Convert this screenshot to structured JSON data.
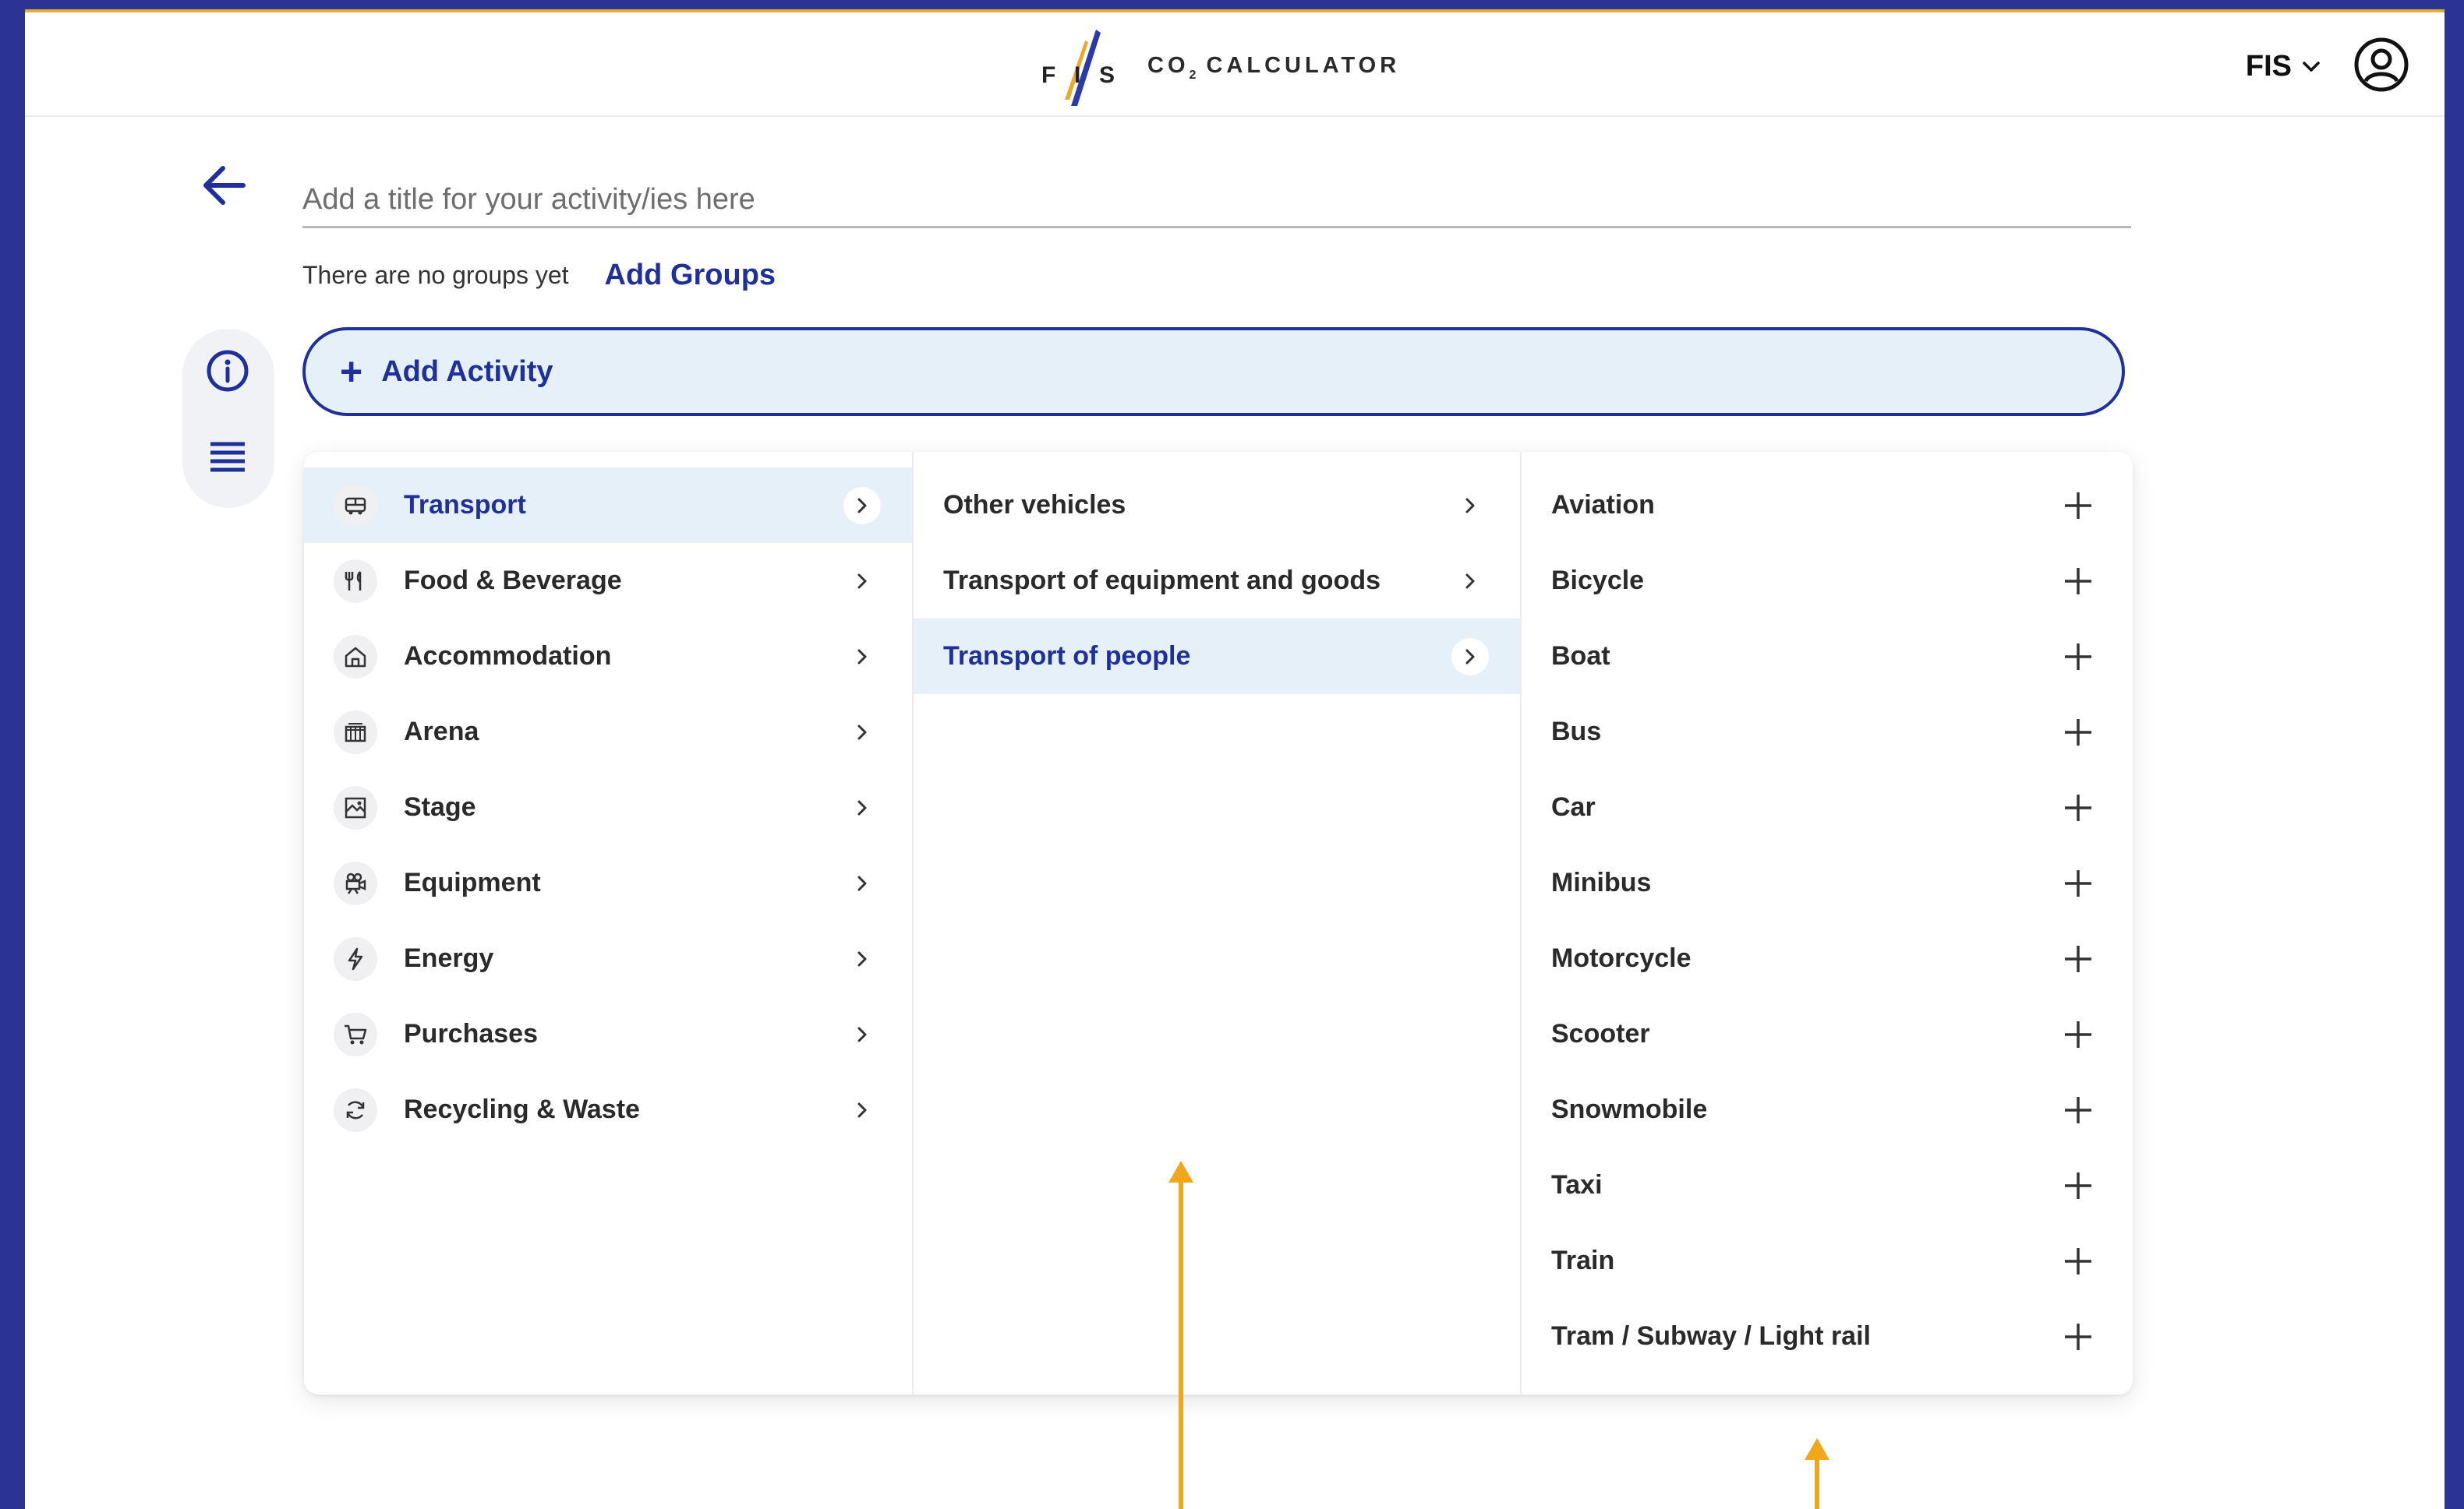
{
  "header": {
    "app_title_main": "CO",
    "app_title_sub": "2",
    "app_title_rest": " CALCULATOR",
    "org_label": "FIS"
  },
  "title_input": {
    "placeholder": "Add a title for your activity/ies here",
    "value": ""
  },
  "groups": {
    "empty_text": "There are no groups yet",
    "add_label": "Add Groups"
  },
  "add_activity": {
    "label": "Add Activity"
  },
  "categories": [
    {
      "label": "Transport",
      "icon": "bus-icon",
      "active": true
    },
    {
      "label": "Food & Beverage",
      "icon": "cutlery-icon",
      "active": false
    },
    {
      "label": "Accommodation",
      "icon": "house-icon",
      "active": false
    },
    {
      "label": "Arena",
      "icon": "stadium-icon",
      "active": false
    },
    {
      "label": "Stage",
      "icon": "stage-icon",
      "active": false
    },
    {
      "label": "Equipment",
      "icon": "camera-icon",
      "active": false
    },
    {
      "label": "Energy",
      "icon": "lightning-icon",
      "active": false
    },
    {
      "label": "Purchases",
      "icon": "cart-icon",
      "active": false
    },
    {
      "label": "Recycling & Waste",
      "icon": "recycle-icon",
      "active": false
    }
  ],
  "subcategories": [
    {
      "label": "Other vehicles",
      "active": false
    },
    {
      "label": "Transport of equipment and goods",
      "active": false
    },
    {
      "label": "Transport of people",
      "active": true
    }
  ],
  "vehicles": [
    "Aviation",
    "Bicycle",
    "Boat",
    "Bus",
    "Car",
    "Minibus",
    "Motorcycle",
    "Scooter",
    "Snowmobile",
    "Taxi",
    "Train",
    "Tram / Subway / Light rail"
  ],
  "colors": {
    "brand_blue": "#20309a",
    "active_bg": "#e6f0f8",
    "accent_yellow": "#f0a81a",
    "frame": "#2b3393"
  }
}
